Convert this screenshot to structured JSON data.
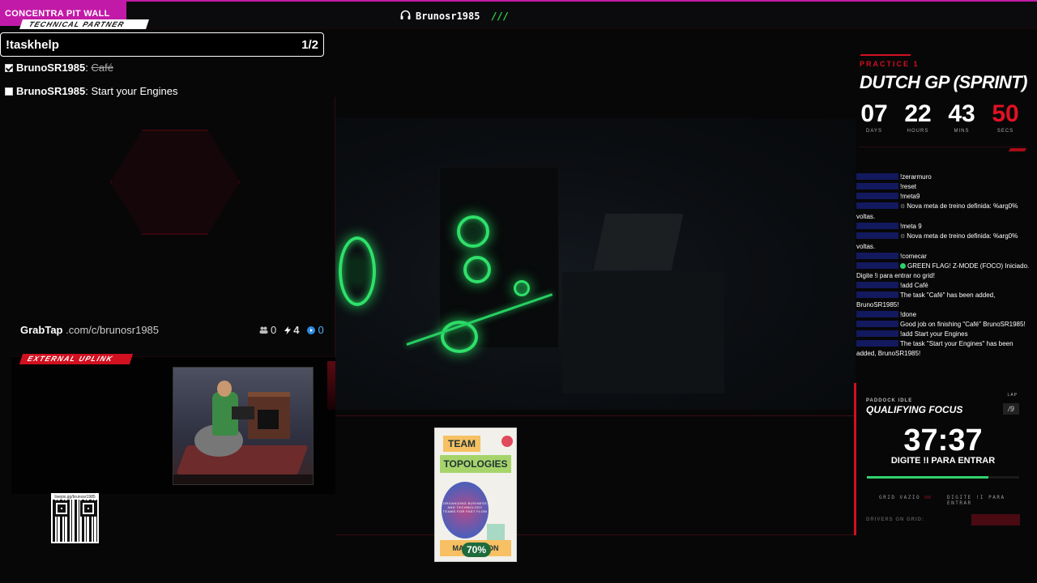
{
  "top": {
    "brand": "CONCENTRA PIT WALL",
    "username": "Brunosr1985",
    "slashes": "///"
  },
  "tech_partner": {
    "tag": "TECHNICAL PARTNER",
    "command": "!taskhelp",
    "page": "1/2",
    "tasks": [
      {
        "user": "BrunoSR1985",
        "sep": ":",
        "text": "Café",
        "done": true
      },
      {
        "user": "BrunoSR1985",
        "sep": ":",
        "text": "Start your Engines",
        "done": false
      }
    ]
  },
  "grabtap": {
    "brand": "GrabTap",
    "url": ".com/c/brunosr1985",
    "users": "0",
    "bolts": "4",
    "points": "0"
  },
  "uplink": {
    "tag": "EXTERNAL UPLINK"
  },
  "qr": {
    "url": "livepix.gg/brunosr1985"
  },
  "book": {
    "title_1": "TEAM",
    "title_2": "TOPOLOGIES",
    "subtitle": "ORGANIZING BUSINESS AND TECHNOLOGY TEAMS FOR FAST FLOW",
    "authors": "MATTH      LTON",
    "progress": "70%"
  },
  "race": {
    "session": "PRACTICE 1",
    "title": "DUTCH GP (SPRINT)",
    "countdown": [
      {
        "value": "07",
        "label": "DAYS"
      },
      {
        "value": "22",
        "label": "HOURS"
      },
      {
        "value": "43",
        "label": "MINS"
      },
      {
        "value": "50",
        "label": "SECS"
      }
    ]
  },
  "chat": [
    {
      "text": "!zerarmuro"
    },
    {
      "text": "!reset"
    },
    {
      "text": "!meta9"
    },
    {
      "text": "Nova meta de treino definida: %arg0% voltas.",
      "icon": "bot"
    },
    {
      "text": "!meta 9"
    },
    {
      "text": "Nova meta de treino definida: %arg0% voltas.",
      "icon": "bot"
    },
    {
      "text": "!comecar"
    },
    {
      "text": "GREEN FLAG! Z-MODE (FOCO) Iniciado. Digite !i para entrar no grid!",
      "icon": "green"
    },
    {
      "text": "!add Café"
    },
    {
      "text": "The task \"Café\" has been added, BrunoSR1985!"
    },
    {
      "text": "!done"
    },
    {
      "text": "Good job on finishing \"Café\" BrunoSR1985!"
    },
    {
      "text": "!add Start your Engines"
    },
    {
      "text": "The task \"Start your Engines\" has been added, BrunoSR1985!"
    }
  ],
  "focus": {
    "status": "PADDOCK IDLE",
    "lap_label": "LAP",
    "lap_value": "/9",
    "mode": "QUALIFYING FOCUS",
    "timer": "37:37",
    "prompt": "DIGITE !I PARA ENTRAR",
    "progress": 0.8,
    "grid_empty": "GRID VAZIO",
    "grid_prompt": "DIGITE !I PARA ENTRAR",
    "drivers_label": "DRIVERS ON GRID:"
  },
  "colors": {
    "brand": "#c21aa8",
    "accent_red": "#d11020",
    "accent_green": "#2ed26a",
    "chat_nick": "#2c3cff"
  }
}
